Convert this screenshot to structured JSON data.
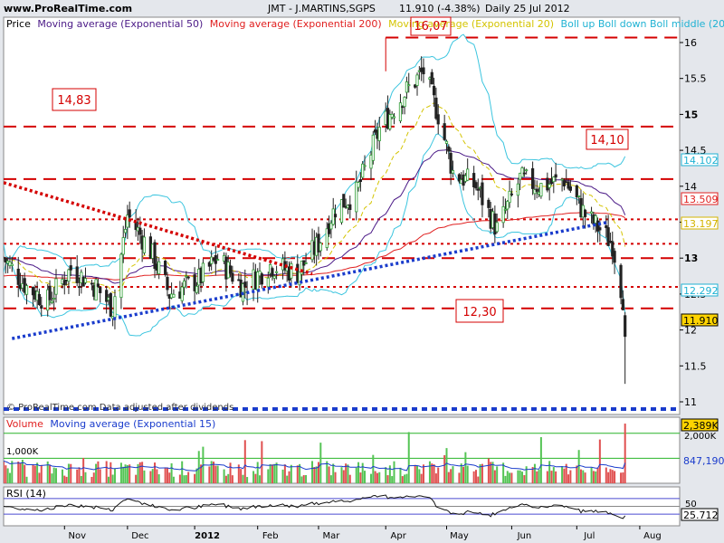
{
  "header": {
    "site": "www.ProRealTime.com",
    "title": "JMT - J.MARTINS,SGPS",
    "last_price": "11.910 (-4.38%)",
    "period_date": "Daily  25 Jul 2012"
  },
  "colors": {
    "background": "#e4e7ec",
    "panel": "#ffffff",
    "candle_up": "#2e9d34",
    "candle_down": "#222222",
    "ema50": "#4b1a87",
    "ema200": "#e02020",
    "ema20": "#d4c400",
    "bollinger": "#3cc5df",
    "resistance": "#d40000",
    "support": "#1a3ccc"
  },
  "price_panel": {
    "legend": [
      {
        "text": "Price",
        "color": "#000000"
      },
      {
        "text": "Moving average (Exponential 50)",
        "color": "#4b1a87"
      },
      {
        "text": "Moving average (Exponential 200)",
        "color": "#e02020"
      },
      {
        "text": "Moving average (Exponential 20)",
        "color": "#d4c400"
      },
      {
        "text": "Boll up Boll down Boll middle (20 2)",
        "color": "#1fb2d3"
      }
    ],
    "watermark": "© ProRealTime.com  Data adjusted after dividends",
    "annotations": [
      "16,07",
      "14,83",
      "14,10",
      "12,30"
    ],
    "tags": [
      {
        "text": "14.102",
        "color": "#1fb2d3"
      },
      {
        "text": "13.509",
        "color": "#e02020"
      },
      {
        "text": "13.197",
        "color": "#d4b400"
      },
      {
        "text": "12.292",
        "color": "#1fb2d3"
      },
      {
        "text": "11.910",
        "color": "#000000"
      }
    ]
  },
  "volume_panel": {
    "legend": [
      {
        "text": "Volume",
        "color": "#e02020"
      },
      {
        "text": "Moving average (Exponential 15)",
        "color": "#1a3ccc"
      }
    ],
    "level_label": "1,000K",
    "tags": [
      {
        "text": "2,389K",
        "color": "#000000"
      },
      {
        "text": "2,000K",
        "color": "#000000"
      },
      {
        "text": "847,190",
        "color": "#1a3ccc"
      }
    ]
  },
  "rsi_panel": {
    "legend": "RSI (14)",
    "tags": [
      {
        "text": "50",
        "color": "#000000"
      },
      {
        "text": "25.712",
        "color": "#000000"
      }
    ]
  },
  "chart_data": [
    {
      "type": "candlestick",
      "y_ticks": [
        "16",
        "15.5",
        "15",
        "14.5",
        "14",
        "13.5",
        "13",
        "12.5",
        "12",
        "11.5",
        "11"
      ],
      "x_ticks": [
        "Nov",
        "Dec",
        "2012",
        "Feb",
        "Mar",
        "Apr",
        "May",
        "Jun",
        "Jul",
        "Aug"
      ],
      "ylim": [
        10.9,
        16.2
      ],
      "resistance_levels": [
        16.07,
        14.83,
        14.1,
        13.54,
        13.2,
        13.0,
        12.6,
        12.3
      ],
      "support_level": 10.9,
      "trendlines": [
        {
          "kind": "resistance",
          "from": [
            "2011-10-03",
            14.05
          ],
          "to": [
            "2012-02-27",
            12.78
          ]
        },
        {
          "kind": "support",
          "from": [
            "2011-10-07",
            11.88
          ],
          "to": [
            "2012-07-17",
            13.5
          ]
        }
      ],
      "anchors": [
        [
          "2011-10-03",
          13.0
        ],
        [
          "2011-10-14",
          12.6
        ],
        [
          "2011-10-24",
          12.4
        ],
        [
          "2011-11-04",
          12.85
        ],
        [
          "2011-11-16",
          12.6
        ],
        [
          "2011-11-24",
          12.3
        ],
        [
          "2011-12-01",
          13.6
        ],
        [
          "2011-12-12",
          13.1
        ],
        [
          "2011-12-21",
          12.5
        ],
        [
          "2012-01-04",
          12.7
        ],
        [
          "2012-01-13",
          13.0
        ],
        [
          "2012-01-25",
          12.6
        ],
        [
          "2012-02-07",
          12.9
        ],
        [
          "2012-02-20",
          12.8
        ],
        [
          "2012-03-01",
          13.2
        ],
        [
          "2012-03-09",
          13.7
        ],
        [
          "2012-03-19",
          13.9
        ],
        [
          "2012-03-30",
          14.8
        ],
        [
          "2012-04-11",
          15.3
        ],
        [
          "2012-04-20",
          15.6
        ],
        [
          "2012-04-27",
          15.0
        ],
        [
          "2012-05-04",
          14.2
        ],
        [
          "2012-05-15",
          14.0
        ],
        [
          "2012-05-25",
          13.4
        ],
        [
          "2012-06-05",
          14.1
        ],
        [
          "2012-06-15",
          14.0
        ],
        [
          "2012-06-26",
          14.1
        ],
        [
          "2012-07-06",
          13.6
        ],
        [
          "2012-07-13",
          13.4
        ],
        [
          "2012-07-19",
          13.2
        ],
        [
          "2012-07-23",
          12.6
        ],
        [
          "2012-07-24",
          12.45
        ],
        [
          "2012-07-25",
          11.91
        ]
      ],
      "last": {
        "date": "2012-07-25",
        "open": 12.2,
        "high": 12.25,
        "low": 11.25,
        "close": 11.91
      }
    },
    {
      "type": "bar",
      "name": "Volume",
      "ylim": [
        0,
        2500
      ],
      "unit": "K",
      "last_value": 2389,
      "ema15_last": 847.19
    },
    {
      "type": "line",
      "name": "RSI (14)",
      "ylim": [
        0,
        100
      ],
      "levels": [
        30,
        50,
        70
      ],
      "last_value": 25.712
    }
  ]
}
